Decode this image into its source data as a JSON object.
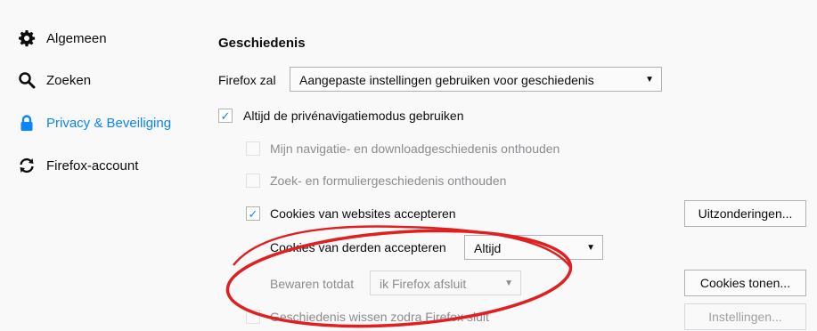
{
  "sidebar": {
    "items": [
      {
        "label": "Algemeen",
        "icon": "gear-icon"
      },
      {
        "label": "Zoeken",
        "icon": "search-icon"
      },
      {
        "label": "Privacy & Beveiliging",
        "icon": "lock-icon",
        "selected": true
      },
      {
        "label": "Firefox-account",
        "icon": "sync-icon"
      }
    ]
  },
  "main": {
    "section_title": "Geschiedenis",
    "firefox_zal_label": "Firefox zal",
    "history_mode_value": "Aangepaste instellingen gebruiken voor geschiedenis",
    "private_mode_label": "Altijd de privénavigatiemodus gebruiken",
    "private_mode_checked": true,
    "remember_browsing_label": "Mijn navigatie- en downloadgeschiedenis onthouden",
    "remember_search_label": "Zoek- en formuliergeschiedenis onthouden",
    "accept_cookies_label": "Cookies van websites accepteren",
    "accept_cookies_checked": true,
    "exceptions_button": "Uitzonderingen...",
    "third_party_label": "Cookies van derden accepteren",
    "third_party_value": "Altijd",
    "keep_until_label": "Bewaren totdat",
    "keep_until_value": "ik Firefox afsluit",
    "show_cookies_button": "Cookies tonen...",
    "clear_history_label": "Geschiedenis wissen zodra Firefox sluit",
    "settings_button": "Instellingen..."
  },
  "colors": {
    "accent": "#0a84ff",
    "annotation": "#e02020"
  }
}
